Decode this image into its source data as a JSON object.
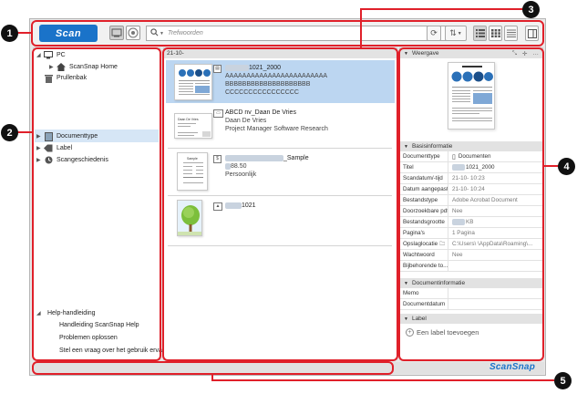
{
  "callouts": [
    "1",
    "2",
    "3",
    "4",
    "5"
  ],
  "toolbar": {
    "scan_label": "Scan",
    "search_placeholder": "Trefwoorden"
  },
  "tree": {
    "pc": "PC",
    "scansnap_home": "ScanSnap Home",
    "trash": "Prullenbak",
    "doctype": "Documenttype",
    "label": "Label",
    "scan_history": "Scangeschiedenis",
    "help": "Help-handleiding",
    "help_items": [
      "Handleiding ScanSnap Help",
      "Problemen oplossen",
      "Stel een vraag over het gebruik ervan"
    ]
  },
  "list": {
    "group_header": "21-10-",
    "items": [
      {
        "title_suffix": "1021_2000",
        "lines": [
          "AAAAAAAAAAAAAAAAAAAAAAAA",
          "BBBBBBBBBBBBBBBBBBBB",
          "CCCCCCCCCCCCCCCC"
        ]
      },
      {
        "title": "ABCD nv_Daan De Vries",
        "lines": [
          "Daan De Vries",
          "Project Manager Software Research"
        ]
      },
      {
        "title_suffix": "_Sample",
        "lines": [
          "88.50",
          "Persoonlijk"
        ]
      },
      {
        "title_suffix": "1021",
        "lines": []
      }
    ]
  },
  "right": {
    "preview_header": "Weergave",
    "basic_header": "Basisinformatie",
    "props": [
      {
        "k": "Documenttype",
        "v": "Documenten"
      },
      {
        "k": "Titel",
        "v": "1021_2000"
      },
      {
        "k": "Scandatum/-tijd",
        "v": "21-10-        10:23"
      },
      {
        "k": "Datum aangepast",
        "v": "21-10-        10:24"
      },
      {
        "k": "Bestandstype",
        "v": "Adobe Acrobat Document"
      },
      {
        "k": "Doorzoekbare pdf",
        "v": "Nee"
      },
      {
        "k": "Bestandsgrootte",
        "v": "KB"
      },
      {
        "k": "Pagina's",
        "v": "1 Pagina"
      },
      {
        "k": "Opslaglocatie",
        "v": "C:\\Users\\        \\AppData\\Roaming\\..."
      },
      {
        "k": "Wachtwoord",
        "v": "Nee"
      },
      {
        "k": "Bijbehorende to...",
        "v": ""
      }
    ],
    "doc_header": "Documentinformatie",
    "doc_props": [
      {
        "k": "Memo",
        "v": ""
      },
      {
        "k": "Documentdatum",
        "v": ""
      }
    ],
    "label_header": "Label",
    "add_label": "Een label toevoegen"
  },
  "statusbar": {
    "brand": "ScanSnap"
  },
  "colors": {
    "accent": "#1a73c9",
    "callout_line": "#e0202a",
    "selection": "#bcd6f1"
  }
}
